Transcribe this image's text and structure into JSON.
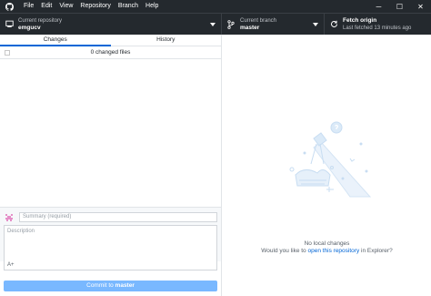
{
  "menu": {
    "items": [
      "File",
      "Edit",
      "View",
      "Repository",
      "Branch",
      "Help"
    ]
  },
  "window_controls": {
    "minimize": "─",
    "maximize": "☐",
    "close": "✕"
  },
  "toolbar": {
    "repo_label": "Current repository",
    "repo_value": "emgucv",
    "branch_label": "Current branch",
    "branch_value": "master",
    "fetch_label": "Fetch origin",
    "fetch_sub": "Last fetched 13 minutes ago"
  },
  "tabs": {
    "changes": "Changes",
    "history": "History"
  },
  "changes": {
    "count_text": "0 changed files"
  },
  "commit": {
    "summary_placeholder": "Summary (required)",
    "description_placeholder": "Description",
    "coauthor": "A+",
    "button_prefix": "Commit to ",
    "button_branch": "master"
  },
  "empty_state": {
    "title": "No local changes",
    "line_prefix": "Would you like to ",
    "link_text": "open this repository",
    "line_suffix": " in Explorer?"
  },
  "colors": {
    "titlebar": "#24292e",
    "accent": "#0366d6",
    "commit_button": "#79b8ff",
    "illustration": "#c8ddf2"
  }
}
